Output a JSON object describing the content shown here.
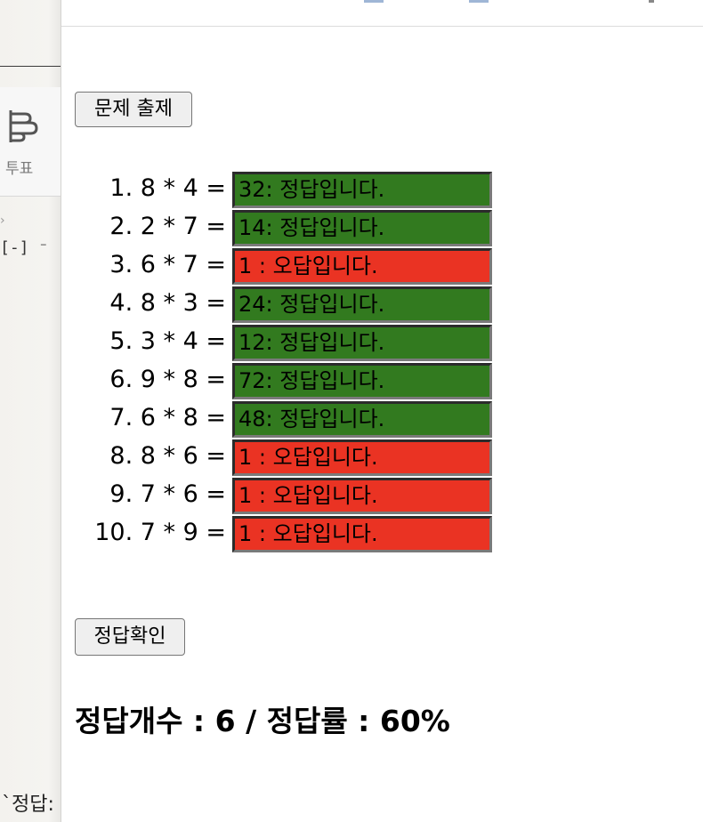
{
  "sidebar": {
    "vote_label": "투표",
    "fragment": "[-] ⁻",
    "bottom_text": "`정답:"
  },
  "buttons": {
    "generate_label": "문제 출제",
    "check_label": "정답확인"
  },
  "questions": [
    {
      "label": "1. 8 * 4 =",
      "answer": "32: 정답입니다.",
      "status": "correct"
    },
    {
      "label": "2. 2 * 7 =",
      "answer": "14: 정답입니다.",
      "status": "correct"
    },
    {
      "label": "3. 6 * 7 =",
      "answer": "1 : 오답입니다.",
      "status": "wrong"
    },
    {
      "label": "4. 8 * 3 =",
      "answer": "24: 정답입니다.",
      "status": "correct"
    },
    {
      "label": "5. 3 * 4 =",
      "answer": "12: 정답입니다.",
      "status": "correct"
    },
    {
      "label": "6. 9 * 8 =",
      "answer": "72: 정답입니다.",
      "status": "correct"
    },
    {
      "label": "7. 6 * 8 =",
      "answer": "48: 정답입니다.",
      "status": "correct"
    },
    {
      "label": "8. 8 * 6 =",
      "answer": "1 : 오답입니다.",
      "status": "wrong"
    },
    {
      "label": "9. 7 * 6 =",
      "answer": "1 : 오답입니다.",
      "status": "wrong"
    },
    {
      "label": "10. 7 * 9 =",
      "answer": "1 : 오답입니다.",
      "status": "wrong"
    }
  ],
  "colors": {
    "correct": "#327a1f",
    "wrong": "#ea3323"
  },
  "result": {
    "text": "정답개수 : 6 / 정답률 : 60%"
  }
}
